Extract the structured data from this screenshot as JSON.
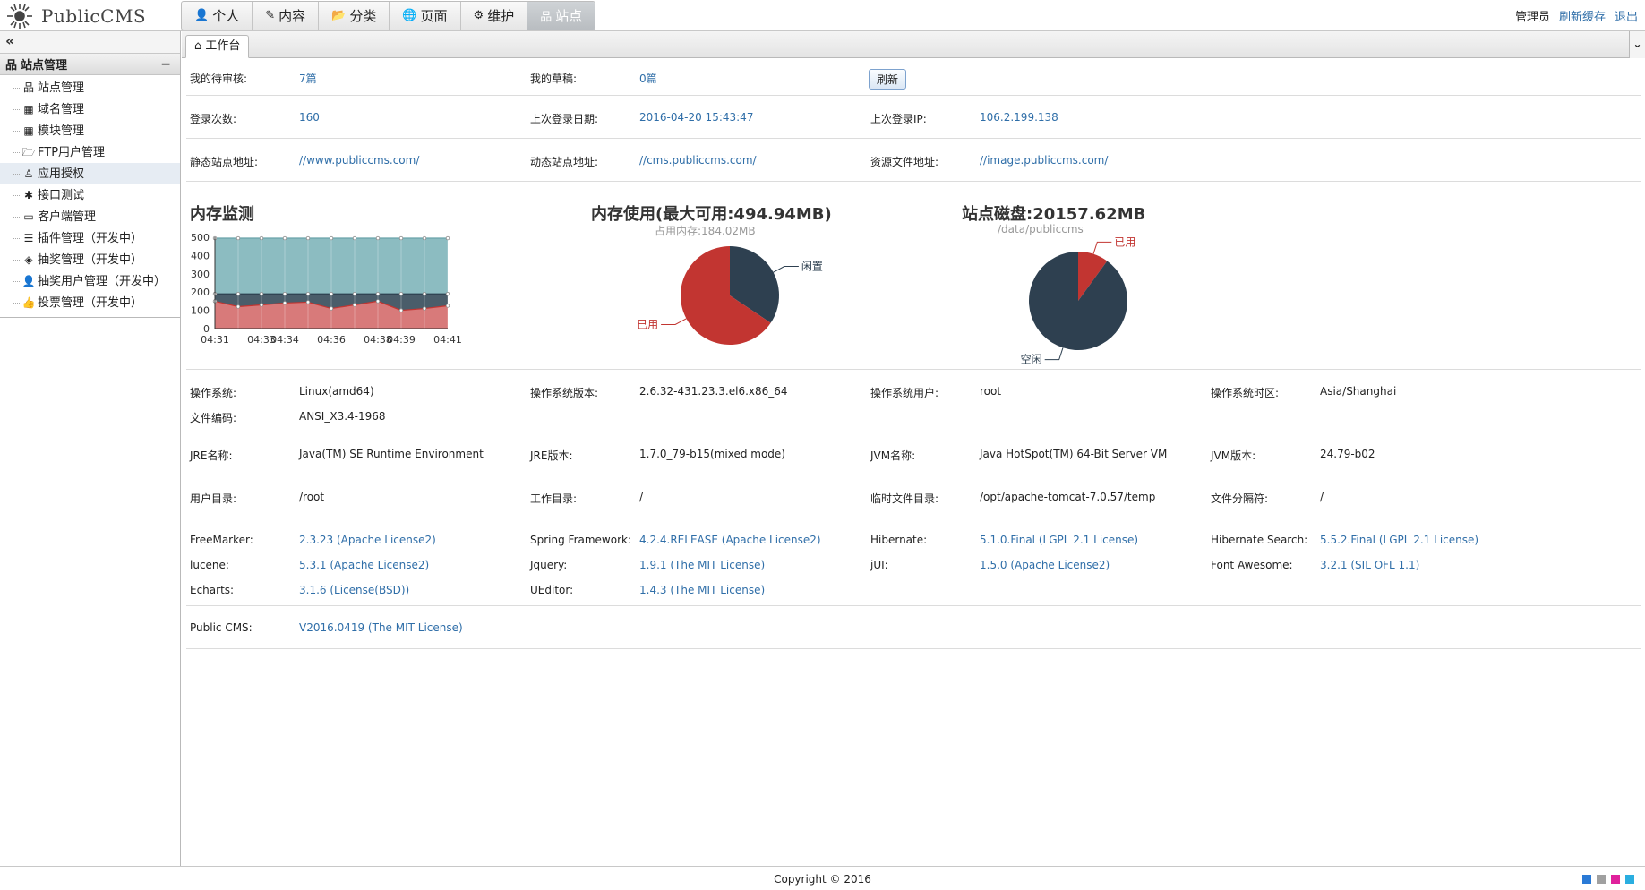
{
  "app": {
    "logo_text": "PublicCMS"
  },
  "nav": [
    {
      "icon": "user-icon",
      "glyph": "👤",
      "label": "个人"
    },
    {
      "icon": "edit-icon",
      "glyph": "✎",
      "label": "内容"
    },
    {
      "icon": "folder-icon",
      "glyph": "📂",
      "label": "分类"
    },
    {
      "icon": "globe-icon",
      "glyph": "🌐",
      "label": "页面"
    },
    {
      "icon": "gear-icon",
      "glyph": "⚙",
      "label": "维护"
    },
    {
      "icon": "sitemap-icon",
      "glyph": "品",
      "label": "站点",
      "active": true
    }
  ],
  "userbar": {
    "admin": "管理员",
    "refresh_cache": "刷新缓存",
    "logout": "退出"
  },
  "sidebar": {
    "collapse_glyph": "«",
    "section_title": "站点管理",
    "items": [
      {
        "icon": "sitemap-icon",
        "glyph": "品",
        "label": "站点管理"
      },
      {
        "icon": "domain-icon",
        "glyph": "▦",
        "label": "域名管理"
      },
      {
        "icon": "module-icon",
        "glyph": "▦",
        "label": "模块管理"
      },
      {
        "icon": "folder-open-icon",
        "glyph": "🗁",
        "label": "FTP用户管理"
      },
      {
        "icon": "linux-icon",
        "glyph": "♙",
        "label": "应用授权",
        "selected": true
      },
      {
        "icon": "bug-icon",
        "glyph": "✱",
        "label": "接口测试"
      },
      {
        "icon": "laptop-icon",
        "glyph": "▭",
        "label": "客户端管理"
      },
      {
        "icon": "tasks-icon",
        "glyph": "☰",
        "label": "插件管理（开发中）"
      },
      {
        "icon": "ticket-icon",
        "glyph": "◈",
        "label": "抽奖管理（开发中）"
      },
      {
        "icon": "user-icon",
        "glyph": "👤",
        "label": "抽奖用户管理（开发中）"
      },
      {
        "icon": "thumbs-up-icon",
        "glyph": "👍",
        "label": "投票管理（开发中）"
      }
    ]
  },
  "tab": {
    "label": "工作台"
  },
  "info": {
    "pending_label": "我的待审核:",
    "pending_value": "7篇",
    "draft_label": "我的草稿:",
    "draft_value": "0篇",
    "refresh_label": "刷新",
    "login_count_label": "登录次数:",
    "login_count_value": "160",
    "last_login_date_label": "上次登录日期:",
    "last_login_date_value": "2016-04-20 15:43:47",
    "last_login_ip_label": "上次登录IP:",
    "last_login_ip_value": "106.2.199.138",
    "static_site_label": "静态站点地址:",
    "static_site_value": "//www.publiccms.com/",
    "dynamic_site_label": "动态站点地址:",
    "dynamic_site_value": "//cms.publiccms.com/",
    "resource_label": "资源文件地址:",
    "resource_value": "//image.publiccms.com/"
  },
  "charts": {
    "memory_monitor_title": "内存监测",
    "memory_usage_title": "内存使用(最大可用:494.94MB)",
    "memory_usage_sub": "占用内存:184.02MB",
    "disk_title": "站点磁盘:20157.62MB",
    "disk_sub": "/data/publiccms",
    "pie_free": "闲置",
    "pie_used": "已用",
    "disk_free": "空闲",
    "disk_used": "已用"
  },
  "chart_data": [
    {
      "type": "area",
      "title": "内存监测",
      "x": [
        "04:31",
        "04:32",
        "04:33",
        "04:34",
        "04:35",
        "04:36",
        "04:37",
        "04:38",
        "04:39",
        "04:40",
        "04:41"
      ],
      "x_tick_labels": [
        "04:31",
        "04:33",
        "04:34",
        "04:36",
        "04:38",
        "04:39",
        "04:41"
      ],
      "y_ticks": [
        "500",
        "400",
        "300",
        "200",
        "100",
        "0"
      ],
      "ylim": [
        0,
        500
      ],
      "series": [
        {
          "color": "#8cbcc1",
          "values": [
            495,
            495,
            495,
            495,
            495,
            495,
            495,
            495,
            495,
            495,
            495
          ]
        },
        {
          "color": "#4a5d6a",
          "values": [
            190,
            190,
            190,
            190,
            190,
            190,
            190,
            190,
            190,
            190,
            190
          ]
        },
        {
          "color": "#d87a7a",
          "values": [
            150,
            120,
            130,
            140,
            145,
            110,
            130,
            150,
            100,
            110,
            125
          ]
        }
      ]
    },
    {
      "type": "pie",
      "title": "内存使用(最大可用:494.94MB)",
      "labels": [
        "闲置",
        "已用"
      ],
      "values": [
        170,
        324
      ],
      "colors": [
        "#2e4050",
        "#c23531"
      ]
    },
    {
      "type": "pie",
      "title": "站点磁盘:20157.62MB",
      "labels": [
        "已用",
        "空闲"
      ],
      "values": [
        10,
        90
      ],
      "colors": [
        "#c23531",
        "#2e4050"
      ]
    }
  ],
  "system": {
    "os_label": "操作系统:",
    "os_value": "Linux(amd64)",
    "os_version_label": "操作系统版本:",
    "os_version_value": "2.6.32-431.23.3.el6.x86_64",
    "os_user_label": "操作系统用户:",
    "os_user_value": "root",
    "os_timezone_label": "操作系统时区:",
    "os_timezone_value": "Asia/Shanghai",
    "encoding_label": "文件编码:",
    "encoding_value": "ANSI_X3.4-1968",
    "jre_name_label": "JRE名称:",
    "jre_name_value": "Java(TM) SE Runtime Environment",
    "jre_version_label": "JRE版本:",
    "jre_version_value": "1.7.0_79-b15(mixed mode)",
    "jvm_name_label": "JVM名称:",
    "jvm_name_value": "Java HotSpot(TM) 64-Bit Server VM",
    "jvm_version_label": "JVM版本:",
    "jvm_version_value": "24.79-b02",
    "user_dir_label": "用户目录:",
    "user_dir_value": "/root",
    "work_dir_label": "工作目录:",
    "work_dir_value": "/",
    "temp_dir_label": "临时文件目录:",
    "temp_dir_value": "/opt/apache-tomcat-7.0.57/temp",
    "separator_label": "文件分隔符:",
    "separator_value": "/"
  },
  "libs": {
    "freemarker_label": "FreeMarker:",
    "freemarker_version": "2.3.23",
    "freemarker_license": "Apache License2",
    "spring_label": "Spring Framework:",
    "spring_version": "4.2.4.RELEASE",
    "spring_license": "Apache License2",
    "hibernate_label": "Hibernate:",
    "hibernate_version": "5.1.0.Final",
    "hibernate_license": "LGPL 2.1 License",
    "hsearch_label": "Hibernate Search:",
    "hsearch_version": "5.5.2.Final",
    "hsearch_license": "LGPL 2.1 License",
    "lucene_label": "lucene:",
    "lucene_version": "5.3.1",
    "lucene_license": "Apache License2",
    "jquery_label": "Jquery:",
    "jquery_version": "1.9.1",
    "jquery_license": "The MIT License",
    "jui_label": "jUI:",
    "jui_version": "1.5.0",
    "jui_license": "Apache License2",
    "fa_label": "Font Awesome:",
    "fa_version": "3.2.1",
    "fa_license": "SIL OFL 1.1",
    "echarts_label": "Echarts:",
    "echarts_version": "3.1.6",
    "echarts_license": "License(BSD)",
    "ueditor_label": "UEditor:",
    "ueditor_version": "1.4.3",
    "ueditor_license": "The MIT License",
    "publiccms_label": "Public CMS:",
    "publiccms_version": "V2016.0419",
    "publiccms_license": "The MIT License"
  },
  "footer": {
    "copyright": "Copyright © 2016",
    "theme_colors": [
      "#2a7ad6",
      "#a0a0a0",
      "#e0219c",
      "#2aaee0"
    ]
  }
}
